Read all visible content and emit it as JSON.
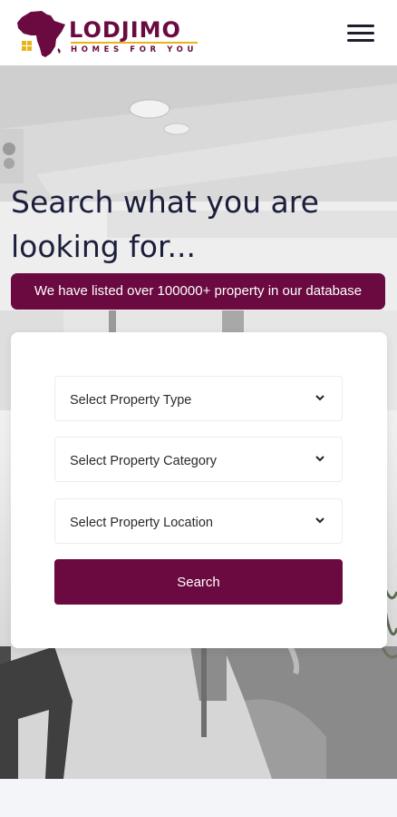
{
  "brand": {
    "name": "LODJIMO",
    "tagline": "HOMES FOR YOU",
    "primary_color": "#6a0a40",
    "accent_color": "#e9b31a"
  },
  "header": {
    "menu_icon": "hamburger-icon"
  },
  "hero": {
    "headline": "Search what you are looking for...",
    "banner": "We have listed over 100000+ property in our database"
  },
  "search_form": {
    "property_type": {
      "label": "Select Property Type"
    },
    "property_category": {
      "label": "Select Property Category"
    },
    "property_location": {
      "label": "Select Property Location"
    },
    "submit_label": "Search"
  }
}
